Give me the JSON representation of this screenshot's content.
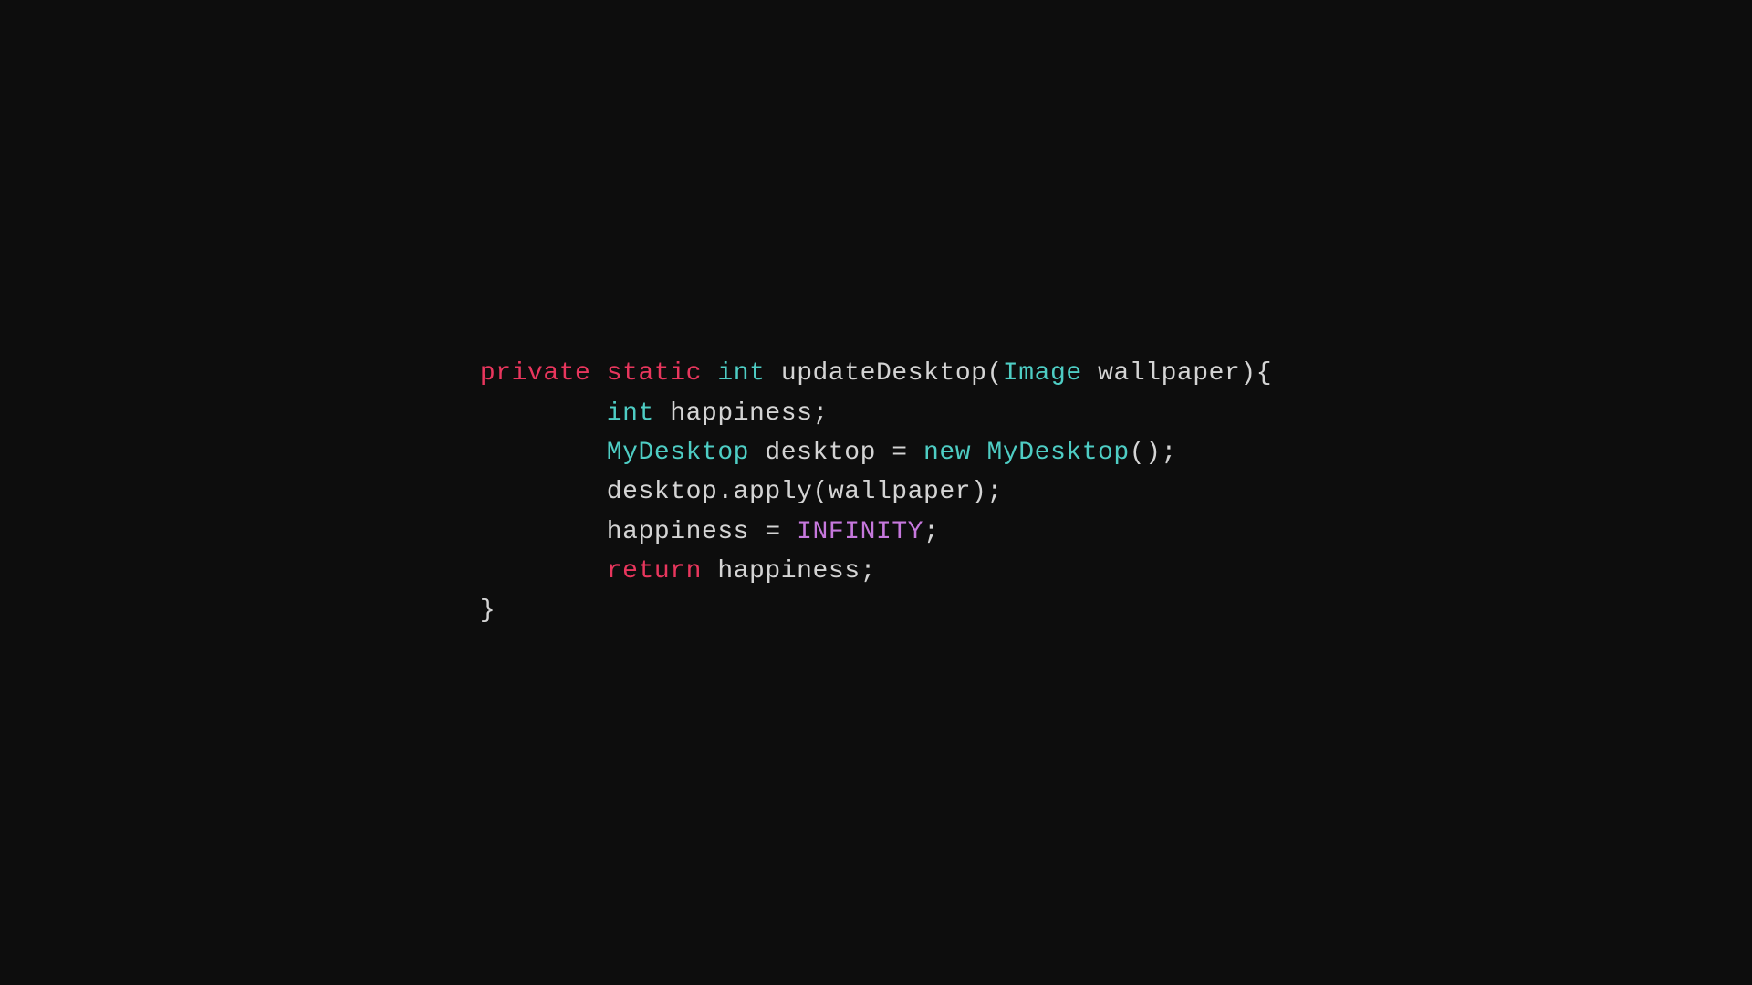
{
  "code": {
    "lines": [
      {
        "id": "line1",
        "segments": [
          {
            "text": "private",
            "cls": "kw-private"
          },
          {
            "text": " "
          },
          {
            "text": "static",
            "cls": "kw-static"
          },
          {
            "text": " "
          },
          {
            "text": "int",
            "cls": "kw-int"
          },
          {
            "text": " updateDesktop("
          },
          {
            "text": "Image",
            "cls": "cls-image"
          },
          {
            "text": " wallpaper){"
          }
        ]
      },
      {
        "id": "line2",
        "indent": "    ",
        "segments": [
          {
            "text": "int",
            "cls": "kw-int"
          },
          {
            "text": " happiness;"
          }
        ]
      },
      {
        "id": "line3",
        "indent": "    ",
        "segments": [
          {
            "text": "MyDesktop",
            "cls": "cls-my-desktop"
          },
          {
            "text": " desktop = "
          },
          {
            "text": "new",
            "cls": "kw-new"
          },
          {
            "text": " "
          },
          {
            "text": "MyDesktop",
            "cls": "cls-my-desktop"
          },
          {
            "text": "();"
          }
        ]
      },
      {
        "id": "line4",
        "indent": "    ",
        "segments": [
          {
            "text": "desktop.apply(wallpaper);"
          }
        ]
      },
      {
        "id": "line5",
        "indent": "    ",
        "segments": [
          {
            "text": "happiness = "
          },
          {
            "text": "INFINITY",
            "cls": "kw-infinity"
          },
          {
            "text": ";"
          }
        ]
      },
      {
        "id": "line6",
        "indent": "    ",
        "segments": [
          {
            "text": "return",
            "cls": "kw-return"
          },
          {
            "text": " happiness;"
          }
        ]
      },
      {
        "id": "line7",
        "indent": "",
        "segments": [
          {
            "text": "}"
          }
        ]
      }
    ]
  }
}
